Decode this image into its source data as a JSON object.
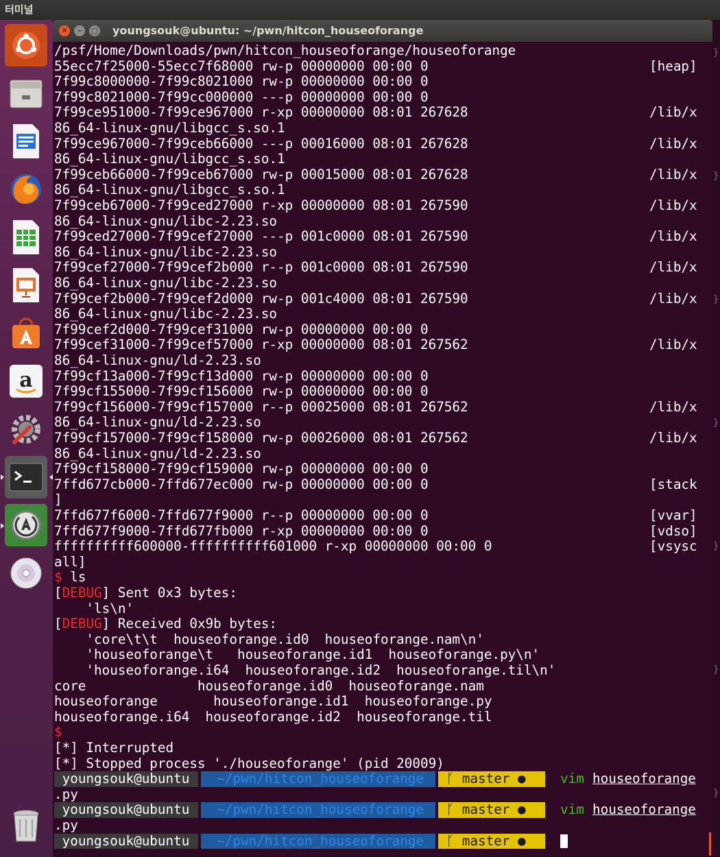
{
  "topbar": {
    "title": "터미널"
  },
  "window": {
    "title": "youngsouk@ubuntu: ~/pwn/hitcon_houseoforange"
  },
  "launcher": {
    "items": [
      "dash-icon",
      "files-icon",
      "writer-icon",
      "firefox-icon",
      "calc-icon",
      "impress-icon",
      "software-center-icon",
      "amazon-icon",
      "settings-icon",
      "terminal-icon",
      "updater-icon",
      "dvd-icon",
      "trash-icon"
    ]
  },
  "terminal": {
    "lines": [
      "/psf/Home/Downloads/pwn/hitcon_houseoforange/houseoforange",
      "55ecc7f25000-55ecc7f68000 rw-p 00000000 00:00 0",
      "7f99c8000000-7f99c8021000 rw-p 00000000 00:00 0",
      "7f99c8021000-7f99cc000000 ---p 00000000 00:00 0",
      "7f99ce951000-7f99ce967000 r-xp 00000000 08:01 267628",
      "86_64-linux-gnu/libgcc_s.so.1",
      "7f99ce967000-7f99ceb66000 ---p 00016000 08:01 267628",
      "86_64-linux-gnu/libgcc_s.so.1",
      "7f99ceb66000-7f99ceb67000 rw-p 00015000 08:01 267628",
      "86_64-linux-gnu/libgcc_s.so.1",
      "7f99ceb67000-7f99ced27000 r-xp 00000000 08:01 267590",
      "86_64-linux-gnu/libc-2.23.so",
      "7f99ced27000-7f99cef27000 ---p 001c0000 08:01 267590",
      "86_64-linux-gnu/libc-2.23.so",
      "7f99cef27000-7f99cef2b000 r--p 001c0000 08:01 267590",
      "86_64-linux-gnu/libc-2.23.so",
      "7f99cef2b000-7f99cef2d000 rw-p 001c4000 08:01 267590",
      "86_64-linux-gnu/libc-2.23.so",
      "7f99cef2d000-7f99cef31000 rw-p 00000000 00:00 0",
      "7f99cef31000-7f99cef57000 r-xp 00000000 08:01 267562",
      "86_64-linux-gnu/ld-2.23.so",
      "7f99cf13a000-7f99cf13d000 rw-p 00000000 00:00 0",
      "7f99cf155000-7f99cf156000 rw-p 00000000 00:00 0",
      "7f99cf156000-7f99cf157000 r--p 00025000 08:01 267562",
      "86_64-linux-gnu/ld-2.23.so",
      "7f99cf157000-7f99cf158000 rw-p 00026000 08:01 267562",
      "86_64-linux-gnu/ld-2.23.so",
      "7f99cf158000-7f99cf159000 rw-p 00000000 00:00 0",
      "7ffd677cb000-7ffd677ec000 rw-p 00000000 00:00 0",
      "]",
      "7ffd677f6000-7ffd677f9000 r--p 00000000 00:00 0",
      "7ffd677f9000-7ffd677fb000 r-xp 00000000 00:00 0",
      "ffffffffff600000-ffffffffff601000 r-xp 00000000 00:00 0",
      "all]",
      " ls",
      "] Sent 0x3 bytes:",
      "    'ls\\n'",
      "] Received 0x9b bytes:",
      "    'core\\t\\t  houseoforange.id0  houseoforange.nam\\n'",
      "    'houseoforange\\t   houseoforange.id1  houseoforange.py\\n'",
      "    'houseoforange.i64  houseoforange.id2  houseoforange.til\\n'",
      "core              houseoforange.id0  houseoforange.nam",
      "houseoforange       houseoforange.id1  houseoforange.py",
      "houseoforange.i64  houseoforange.id2  houseoforange.til",
      "] Interrupted",
      "] Stopped process './houseoforange' (pid 20009)",
      ".py",
      ".py"
    ],
    "right": {
      "heap": "[heap]",
      "lib": "/lib/x",
      "stack": "[stack",
      "vvar": "[vvar]",
      "vdso": "[vdso]",
      "vsysc": "[vsysc"
    },
    "prompt_symbol": "$",
    "debug_tag": "DEBUG",
    "bracket_open": "[",
    "star_tag": "[*",
    "prompt": {
      "user": " youngsouk@ubuntu ",
      "path": "  ~/pwn/hitcon_houseoforange ",
      "branch": " ᚴ master ● ",
      "cmd": "vim",
      "file": "houseoforange"
    }
  },
  "colors": {
    "terminal_bg": "#300a24",
    "prompt_path": "#1f5b9e",
    "prompt_git": "#e4c400",
    "debug": "#ef2929"
  }
}
